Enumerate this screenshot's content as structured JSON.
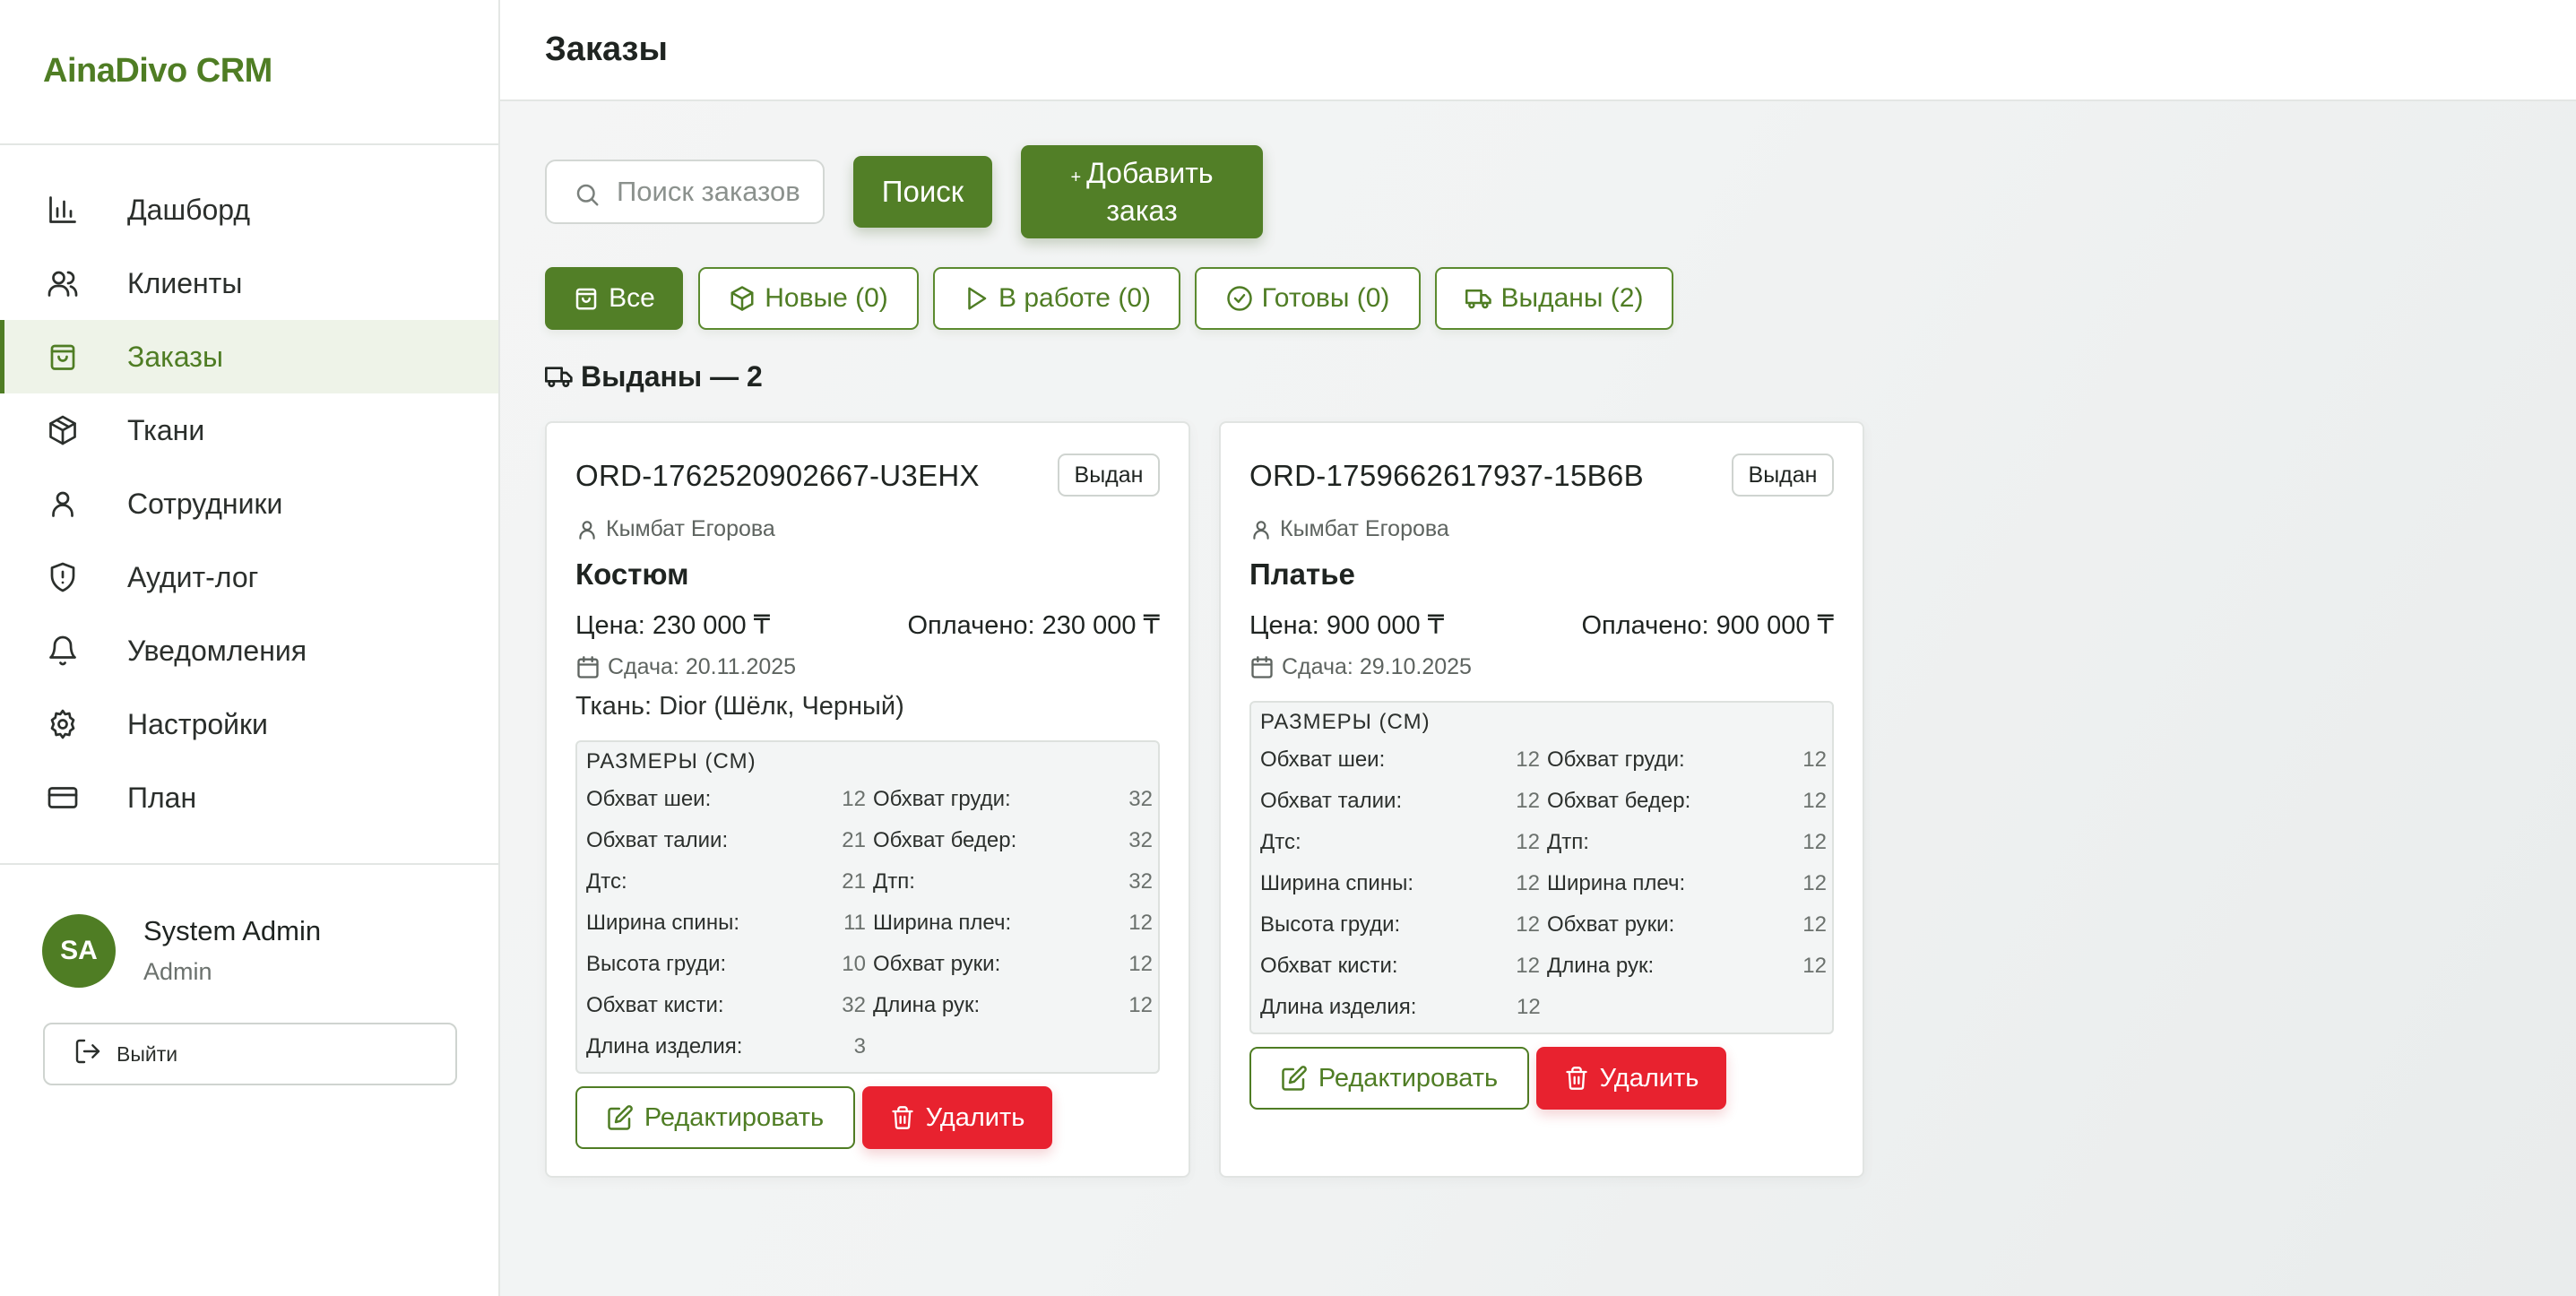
{
  "app": {
    "name": "AinaDivo CRM",
    "accent_color": "#4f7d24",
    "danger_color": "#e8222f"
  },
  "sidebar": {
    "items": [
      {
        "label": "Дашборд",
        "icon": "bar-chart-icon",
        "active": false
      },
      {
        "label": "Клиенты",
        "icon": "users-icon",
        "active": false
      },
      {
        "label": "Заказы",
        "icon": "shopping-bag-icon",
        "active": true
      },
      {
        "label": "Ткани",
        "icon": "package-icon",
        "active": false
      },
      {
        "label": "Сотрудники",
        "icon": "user-icon",
        "active": false
      },
      {
        "label": "Аудит-лог",
        "icon": "shield-alert-icon",
        "active": false
      },
      {
        "label": "Уведомления",
        "icon": "bell-icon",
        "active": false
      },
      {
        "label": "Настройки",
        "icon": "gear-icon",
        "active": false
      },
      {
        "label": "План",
        "icon": "credit-card-icon",
        "active": false
      }
    ],
    "user": {
      "initials": "SA",
      "name": "System Admin",
      "role": "Admin"
    },
    "logout_label": "Выйти"
  },
  "header": {
    "title": "Заказы"
  },
  "toolbar": {
    "search_placeholder": "Поиск заказов",
    "search_value": "",
    "search_button": "Поиск",
    "add_plus": "+",
    "add_button": "Добавить заказ"
  },
  "filters": [
    {
      "label": "Все",
      "icon": "shopping-bag-icon",
      "active": true
    },
    {
      "label": "Новые (0)",
      "icon": "package-icon",
      "active": false
    },
    {
      "label": "В работе (0)",
      "icon": "play-icon",
      "active": false
    },
    {
      "label": "Готовы (0)",
      "icon": "check-circle-icon",
      "active": false
    },
    {
      "label": "Выданы (2)",
      "icon": "truck-icon",
      "active": false
    }
  ],
  "section": {
    "title": "Выданы — 2",
    "icon": "truck-icon"
  },
  "orders": [
    {
      "id": "ORD-1762520902667-U3EHX",
      "status": "Выдан",
      "client": "Кымбат Егорова",
      "product": "Костюм",
      "price": "Цена: 230 000 ₸",
      "paid": "Оплачено: 230 000 ₸",
      "due": "Сдача: 20.11.2025",
      "fabric": "Ткань: Dior (Шёлк, Черный)",
      "measures_title": "РАЗМЕРЫ (СМ)",
      "measures": [
        {
          "label": "Обхват шеи:",
          "value": "12"
        },
        {
          "label": "Обхват груди:",
          "value": "32"
        },
        {
          "label": "Обхват талии:",
          "value": "21"
        },
        {
          "label": "Обхват бедер:",
          "value": "32"
        },
        {
          "label": "Дтс:",
          "value": "21"
        },
        {
          "label": "Дтп:",
          "value": "32"
        },
        {
          "label": "Ширина спины:",
          "value": "11"
        },
        {
          "label": "Ширина плеч:",
          "value": "12"
        },
        {
          "label": "Высота груди:",
          "value": "10"
        },
        {
          "label": "Обхват руки:",
          "value": "12"
        },
        {
          "label": "Обхват кисти:",
          "value": "32"
        },
        {
          "label": "Длина рук:",
          "value": "12"
        },
        {
          "label": "Длина изделия:",
          "value": "3"
        }
      ],
      "edit_label": "Редактировать",
      "delete_label": "Удалить"
    },
    {
      "id": "ORD-1759662617937-15B6B",
      "status": "Выдан",
      "client": "Кымбат Егорова",
      "product": "Платье",
      "price": "Цена: 900 000 ₸",
      "paid": "Оплачено: 900 000 ₸",
      "due": "Сдача: 29.10.2025",
      "fabric": "",
      "measures_title": "РАЗМЕРЫ (СМ)",
      "measures": [
        {
          "label": "Обхват шеи:",
          "value": "12"
        },
        {
          "label": "Обхват груди:",
          "value": "12"
        },
        {
          "label": "Обхват талии:",
          "value": "12"
        },
        {
          "label": "Обхват бедер:",
          "value": "12"
        },
        {
          "label": "Дтс:",
          "value": "12"
        },
        {
          "label": "Дтп:",
          "value": "12"
        },
        {
          "label": "Ширина спины:",
          "value": "12"
        },
        {
          "label": "Ширина плеч:",
          "value": "12"
        },
        {
          "label": "Высота груди:",
          "value": "12"
        },
        {
          "label": "Обхват руки:",
          "value": "12"
        },
        {
          "label": "Обхват кисти:",
          "value": "12"
        },
        {
          "label": "Длина рук:",
          "value": "12"
        },
        {
          "label": "Длина изделия:",
          "value": "12"
        }
      ],
      "edit_label": "Редактировать",
      "delete_label": "Удалить"
    }
  ]
}
